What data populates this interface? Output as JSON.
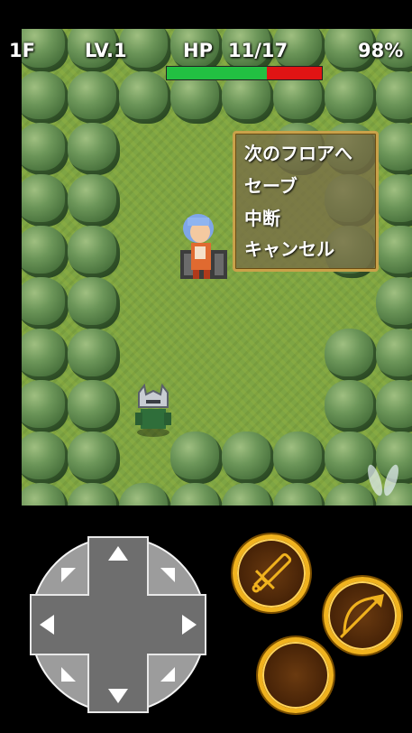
{
  "hud": {
    "floor": "1F",
    "level": "LV.1",
    "hp_label": "HP",
    "hp_value": "11/17",
    "hp_fraction": 0.647,
    "battery": "98%"
  },
  "menu": {
    "items": [
      "次のフロアへ",
      "セーブ",
      "中断",
      "キャンセル"
    ]
  },
  "controls": {
    "dpad_icon": "dpad-icon",
    "attack_icon": "sword-icon",
    "shoot_icon": "bow-icon",
    "extra_icon": "blank"
  },
  "colors": {
    "hp_green": "#22c042",
    "hp_red": "#e01414",
    "button_gold": "#f0b21e"
  }
}
